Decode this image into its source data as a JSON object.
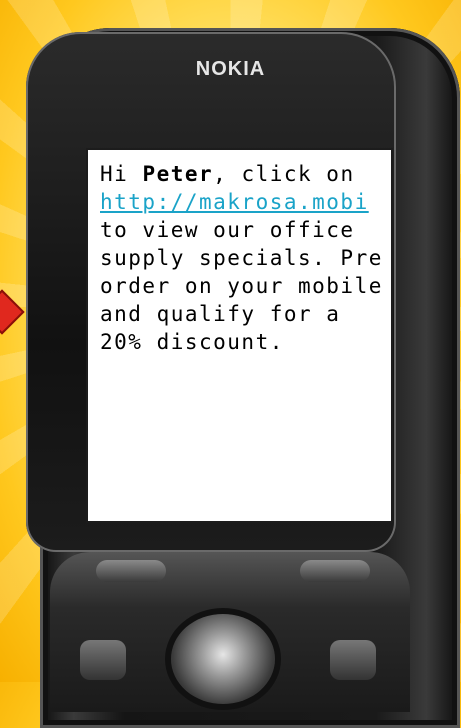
{
  "phone": {
    "brand": "NOKIA"
  },
  "message": {
    "greeting": "Hi ",
    "name": "Peter",
    "after_name": ", click on ",
    "link_text": "http://makrosa.mobi",
    "body": " to view our office supply specials. Pre order on your mobile and qualify for a 20% discount."
  },
  "colors": {
    "link": "#1aa3c8",
    "arrow": "#e0281e",
    "background": "#ffd84a"
  }
}
